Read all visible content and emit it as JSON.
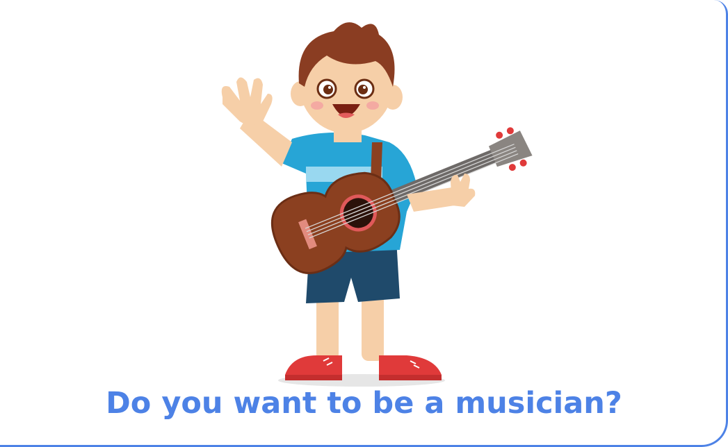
{
  "card": {
    "caption": "Do you want to be a musician?"
  },
  "illustration": {
    "subject": "boy-playing-guitar-illustration"
  },
  "colors": {
    "accent": "#4d82e6",
    "shirt": "#27a5d6",
    "shorts": "#1f4a6b",
    "guitar": "#8b4020",
    "shoes": "#e03a3a",
    "hair": "#8a3d22",
    "skin": "#f6cfa8"
  }
}
